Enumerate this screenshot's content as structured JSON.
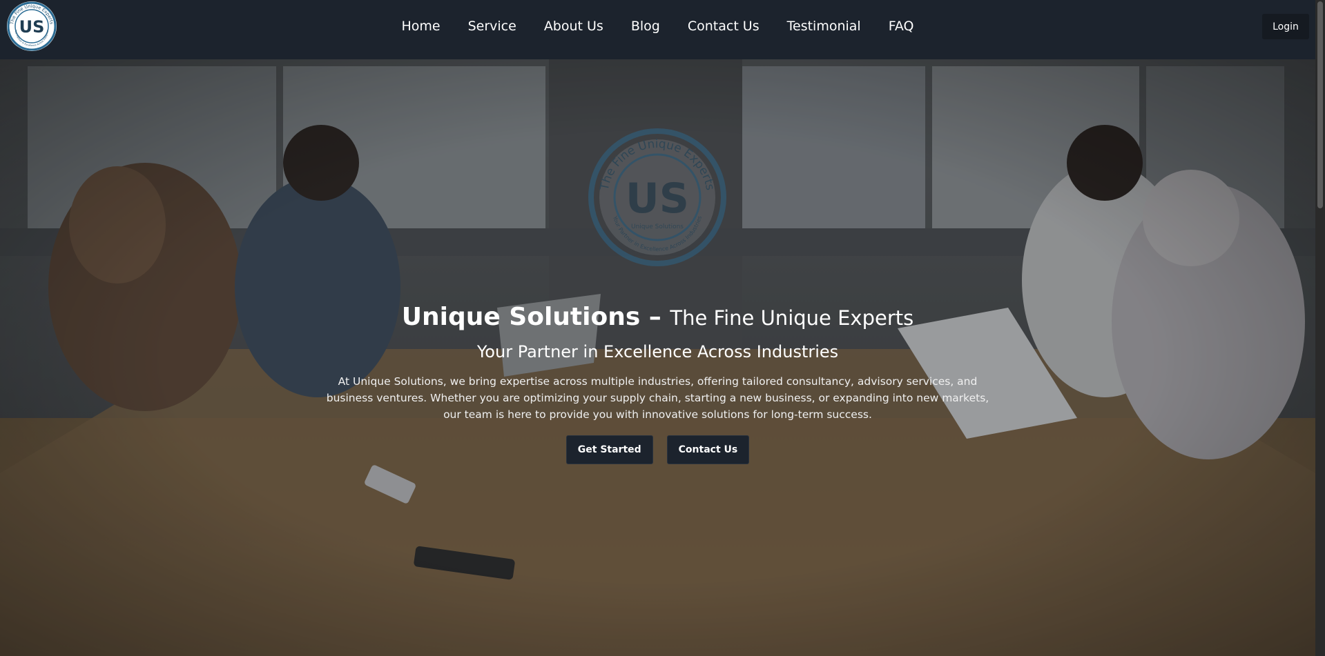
{
  "nav": {
    "links": [
      {
        "label": "Home"
      },
      {
        "label": "Service"
      },
      {
        "label": "About Us"
      },
      {
        "label": "Blog"
      },
      {
        "label": "Contact Us"
      },
      {
        "label": "Testimonial"
      },
      {
        "label": "FAQ"
      }
    ],
    "login_label": "Login"
  },
  "logo": {
    "monogram": "US",
    "ring_text": "The Fine Unique Experts",
    "inner_text": "Unique Solutions",
    "bottom_text": "Your Partner in Excellence Across Industries"
  },
  "hero": {
    "title_main": "Unique Solutions –",
    "title_light": "The Fine Unique Experts",
    "subtitle": "Your Partner in Excellence Across Industries",
    "text": "At Unique Solutions, we bring expertise across multiple industries, offering tailored consultancy, advisory services, and business ventures. Whether you are optimizing your supply chain, starting a new business, or expanding into new markets, our team is here to provide you with innovative solutions for long-term success.",
    "buttons": [
      {
        "label": "Get Started"
      },
      {
        "label": "Contact Us"
      }
    ]
  },
  "colors": {
    "navbar": "#1c232d",
    "button": "#1c232d",
    "logo_blue": "#2b6c94"
  }
}
